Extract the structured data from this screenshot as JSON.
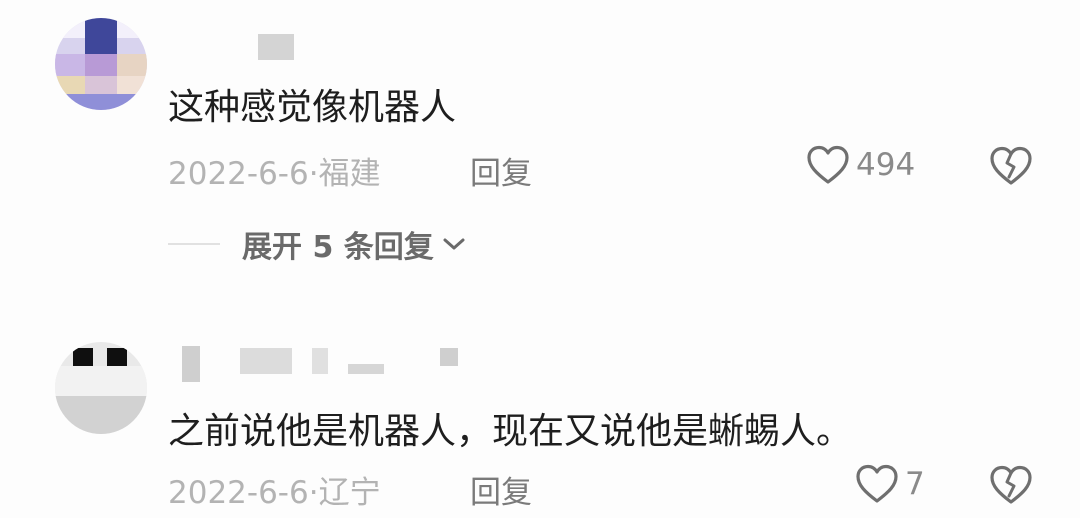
{
  "comments": [
    {
      "text": "这种感觉像机器人",
      "date": "2022-6-6·",
      "location": "福建",
      "reply_label": "回复",
      "likes": "494",
      "like_icon": "heart-outline-icon",
      "dislike_icon": "broken-heart-icon",
      "avatar_colors": [
        "#b9b3dc",
        "#4a4fa0",
        "#e9d9c9",
        "#c8b5e2"
      ]
    },
    {
      "text": "之前说他是机器人，现在又说他是蜥蜴人。",
      "date": "2022-6-6·",
      "location": "辽宁",
      "reply_label": "回复",
      "likes": "7",
      "like_icon": "heart-outline-icon",
      "dislike_icon": "broken-heart-icon",
      "avatar_colors": [
        "#101010",
        "#e6e6e6",
        "#cfcfcf"
      ]
    }
  ],
  "expand_replies": {
    "label": "展开 5 条回复",
    "icon": "chevron-down-icon"
  },
  "colors": {
    "text": "#1e1e1e",
    "meta": "#b3b3b3",
    "icon": "#6f6f6f"
  }
}
